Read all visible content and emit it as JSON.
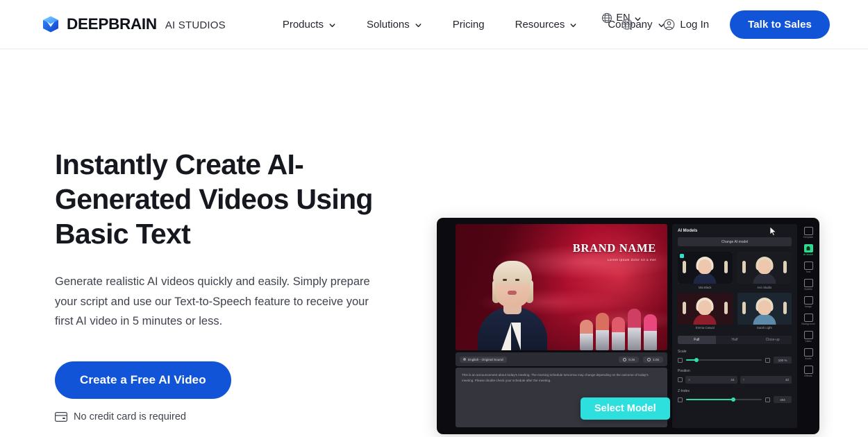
{
  "header": {
    "brand": {
      "word": "DEEPBRAIN",
      "sub": "AI STUDIOS",
      "logo_icon": "cube-logo-icon"
    },
    "nav": [
      {
        "label": "Products",
        "has_caret": true
      },
      {
        "label": "Solutions",
        "has_caret": true
      },
      {
        "label": "Pricing",
        "has_caret": false
      },
      {
        "label": "Resources",
        "has_caret": true
      },
      {
        "label": "Company",
        "has_caret": true
      }
    ],
    "language": {
      "label": "EN",
      "icon": "globe-icon"
    },
    "login": {
      "label": "Log In",
      "icon": "user-circle-icon"
    },
    "cta": {
      "label": "Talk to Sales"
    }
  },
  "hero": {
    "title": "Instantly Create AI-Generated Videos Using Basic Text",
    "subtitle": "Generate realistic AI videos quickly and easily. Simply prepare your script and use our Text-to-Speech feature to receive your first AI video in 5 minutes or less.",
    "cta_label": "Create a Free AI Video",
    "note": "No credit card is required",
    "note_icon": "credit-card-icon"
  },
  "app_mock": {
    "stage": {
      "brand_name": "BRAND NAME",
      "brand_tagline": "Lorem ipsum dolor sit a met"
    },
    "script_bar": {
      "language_pill": "English - Original Sound",
      "time_chips": [
        "0.3s",
        "1.0s"
      ]
    },
    "script_text": "This is an announcement about today's meeting. The morning schedule tomorrow may change depending on the outcome of today's meeting. Please double-check your schedule after the meeting.",
    "models_panel": {
      "title": "AI Models",
      "change_button": "Change AI model",
      "models": [
        {
          "name": "Mia Black",
          "selected": true,
          "bg": "#111217",
          "torso": "#1d2742",
          "hair": "#efe3d2"
        },
        {
          "name": "Ann Studio",
          "selected": false,
          "bg": "#1a1b20",
          "torso": "#2b2d3a",
          "hair": "#e5d7bd"
        },
        {
          "name": "Emma Casual",
          "selected": false,
          "bg": "#2a1118",
          "torso": "#8d1f2c",
          "hair": "#f0e2cb"
        },
        {
          "name": "Sarah Light",
          "selected": false,
          "bg": "#1b2630",
          "torso": "#5d8aa8",
          "hair": "#e7dcc4"
        }
      ],
      "size_tabs": [
        {
          "label": "Full",
          "active": true
        },
        {
          "label": "Half",
          "active": false
        },
        {
          "label": "Close-up",
          "active": false
        }
      ],
      "scale": {
        "label": "Scale",
        "value": "100 %",
        "percent": 14
      },
      "position": {
        "label": "Position",
        "x_axis": "X",
        "x_value": "24",
        "y_axis": "Y",
        "y_value": "42"
      },
      "zindex": {
        "label": "Z-Index",
        "value": "404",
        "percent": 62
      }
    },
    "icon_rail": [
      {
        "label": "Template",
        "icon": "template-icon",
        "active": false
      },
      {
        "label": "AI Model",
        "icon": "ai-model-icon",
        "active": true
      },
      {
        "label": "Text",
        "icon": "text-icon",
        "active": false
      },
      {
        "label": "Subtitle",
        "icon": "subtitle-icon",
        "active": false
      },
      {
        "label": "Image",
        "icon": "image-icon",
        "active": false
      },
      {
        "label": "Background",
        "icon": "background-icon",
        "active": false
      },
      {
        "label": "Video",
        "icon": "video-icon",
        "active": false
      },
      {
        "label": "Audio",
        "icon": "audio-icon",
        "active": false
      },
      {
        "label": "Effects",
        "icon": "effects-icon",
        "active": false
      }
    ],
    "select_model_button": "Select Model"
  },
  "colors": {
    "brand_blue": "#1254d8",
    "accent_cyan": "#2ee0dd",
    "accent_teal": "#2fe0cf",
    "accent_green": "#2fd98f",
    "text_dark": "#16181f",
    "panel_dark": "#17181d"
  }
}
